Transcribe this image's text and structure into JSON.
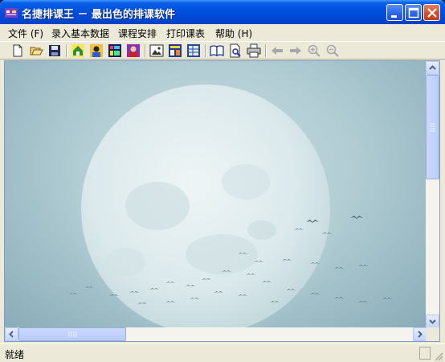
{
  "window": {
    "title": "名捷排课王 － 最出色的排课软件",
    "controls": [
      "minimize-icon",
      "maximize-icon",
      "close-icon"
    ]
  },
  "menu": [
    {
      "label": "文件 (F)",
      "name": "menu-file"
    },
    {
      "label": "录入基本数据",
      "name": "menu-input-data"
    },
    {
      "label": "课程安排",
      "name": "menu-course-schedule"
    },
    {
      "label": "打印课表",
      "name": "menu-print-schedule"
    },
    {
      "label": "帮助 (H)",
      "name": "menu-help"
    }
  ],
  "toolbar": {
    "buttons": [
      "new-document-icon",
      "open-folder-icon",
      "save-icon",
      "home-icon",
      "teacher-icon",
      "class-table-icon",
      "student-icon",
      "image-icon",
      "schedule-icon",
      "preview-table-icon",
      "book-icon",
      "print-preview-icon",
      "printer-icon",
      "back-arrow-icon",
      "forward-arrow-icon",
      "zoom-in-icon",
      "zoom-out-icon"
    ]
  },
  "colors": {
    "titlebar": "#0052e0",
    "moon": "#e6f0f1",
    "sky": "#b2cdd4"
  },
  "status": {
    "text": "就绪"
  }
}
